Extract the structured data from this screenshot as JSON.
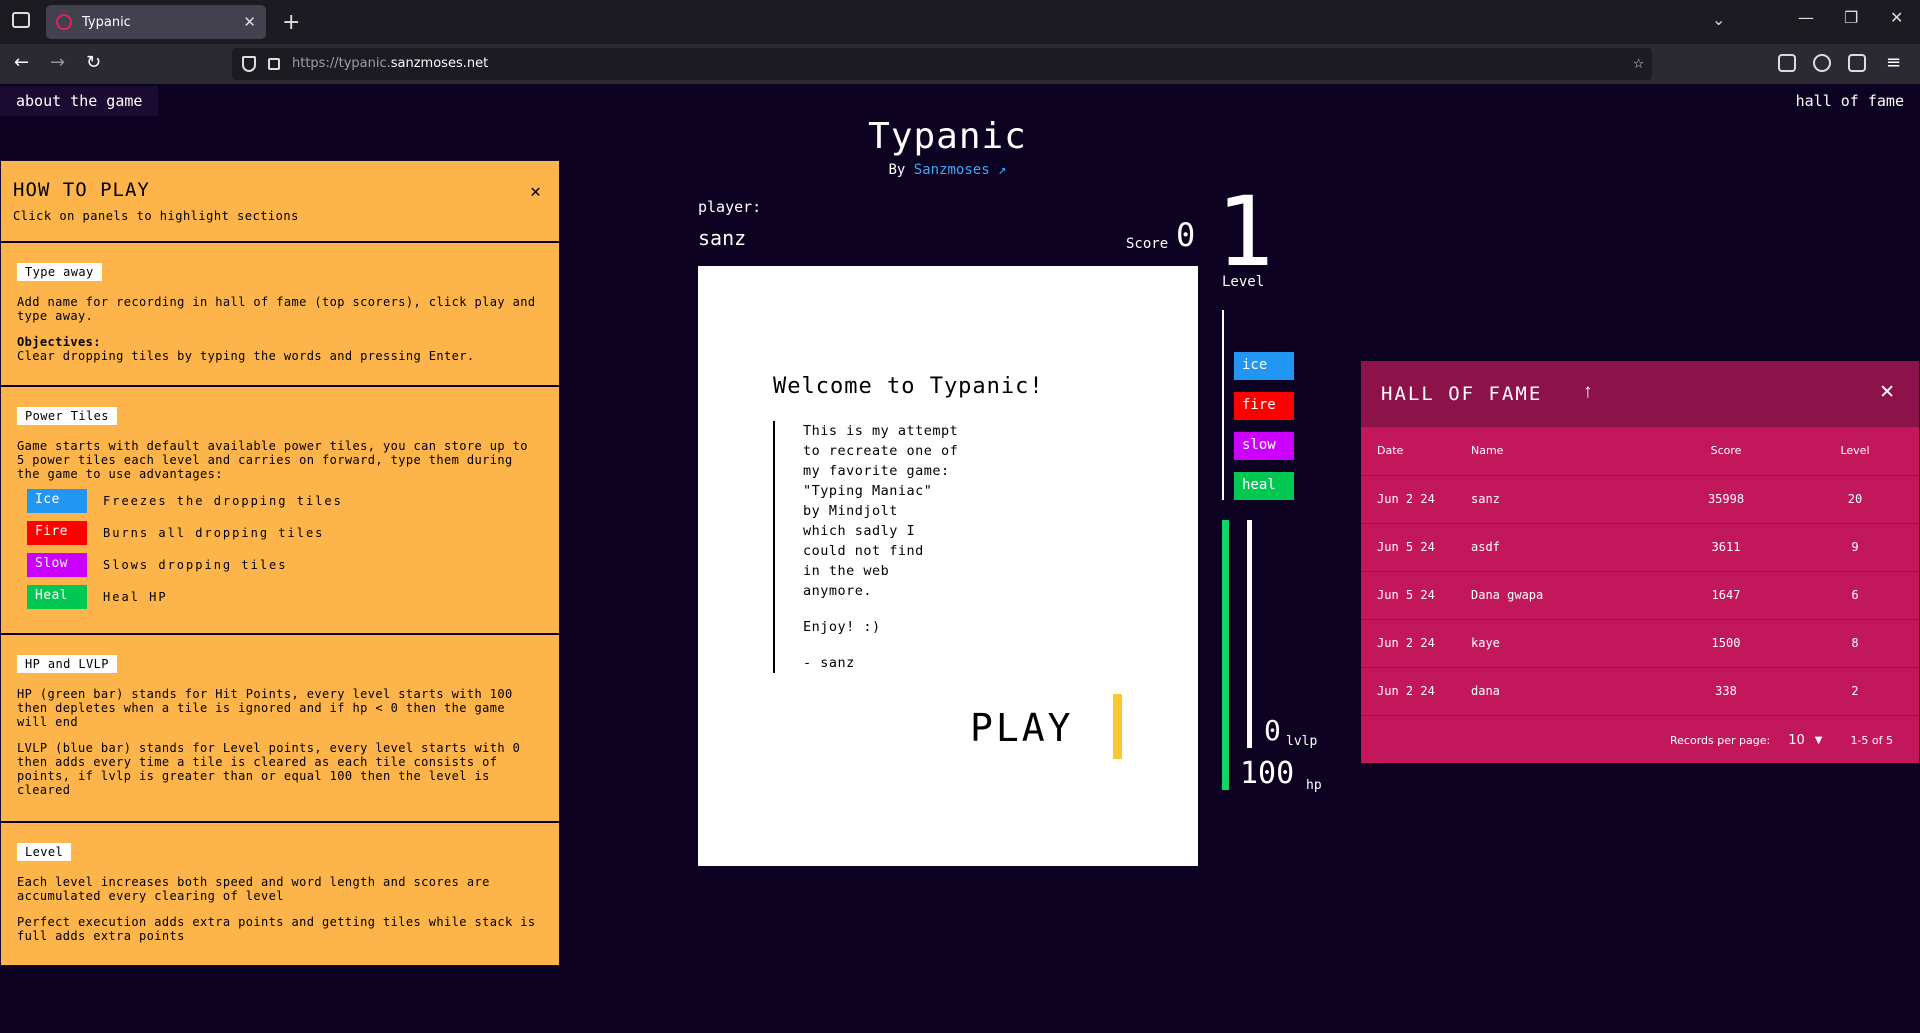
{
  "browser": {
    "tab_title": "Typanic",
    "url_prefix": "https://typanic.",
    "url_domain": "sanzmoses.net"
  },
  "nav": {
    "about": "about the game",
    "hall_of_fame": "hall of fame"
  },
  "header": {
    "title": "Typanic",
    "by": "By",
    "author": "Sanzmoses ↗"
  },
  "how_to_play": {
    "title": "HOW TO PLAY",
    "subtitle": "Click on panels to highlight sections",
    "type_away": {
      "tag": "Type away",
      "text": "Add name for recording in hall of fame (top scorers), click play and type away.",
      "objectives_label": "Objectives:",
      "objectives_text": "Clear dropping tiles by typing the words and pressing Enter."
    },
    "power_tiles": {
      "tag": "Power Tiles",
      "text": "Game starts with default available power tiles, you can store up to 5 power tiles each level and carries on forward, type them during the game to use advantages:",
      "tiles": [
        {
          "label": "Ice",
          "desc": "Freezes the dropping tiles",
          "color": "#2196f3"
        },
        {
          "label": "Fire",
          "desc": "Burns all dropping tiles",
          "color": "#ff0000"
        },
        {
          "label": "Slow",
          "desc": "Slows dropping tiles",
          "color": "#cc00ff"
        },
        {
          "label": "Heal",
          "desc": "Heal HP",
          "color": "#00c853"
        }
      ]
    },
    "hp_lvlp": {
      "tag": "HP and LVLP",
      "hp_text": "HP (green bar) stands for Hit Points, every level starts with 100 then depletes when a tile is ignored and if hp < 0 then the game will end",
      "lvlp_text": "LVLP (blue bar) stands for Level points, every level starts with 0 then adds every time a tile is cleared as each tile consists of points, if lvlp is greater than or equal 100 then the level is cleared"
    },
    "level": {
      "tag": "Level",
      "text1": "Each level increases both speed and word length and scores are accumulated every clearing of level",
      "text2": "Perfect execution adds extra points and getting tiles while stack is full adds extra points"
    }
  },
  "game": {
    "player_label": "player:",
    "player_name": "sanz",
    "score_label": "Score",
    "score": "0",
    "level": "1",
    "level_label": "Level",
    "welcome": "Welcome to Typanic!",
    "quote_lines": [
      "This is my attempt",
      "to recreate one of",
      "my favorite game:",
      "\"Typing Maniac\"",
      "by Mindjolt",
      "which sadly I",
      "could not find",
      "in the web",
      "anymore."
    ],
    "enjoy": "Enjoy! :)",
    "signature": "- sanz",
    "play": "PLAY",
    "power_stack": [
      {
        "label": "ice",
        "color": "#2196f3"
      },
      {
        "label": "fire",
        "color": "#ff0000"
      },
      {
        "label": "slow",
        "color": "#cc00ff"
      },
      {
        "label": "heal",
        "color": "#00c853"
      }
    ],
    "lvlp": "0",
    "lvlp_unit": "lvlp",
    "hp": "100",
    "hp_unit": "hp",
    "hp_percent": 100,
    "lvlp_percent": 0
  },
  "hall_of_fame": {
    "title": "HALL OF FAME",
    "columns": [
      "Date",
      "Name",
      "Score",
      "Level"
    ],
    "rows": [
      [
        "Jun 2 24",
        "sanz",
        "35998",
        "20"
      ],
      [
        "Jun 5 24",
        "asdf",
        "3611",
        "9"
      ],
      [
        "Jun 5 24",
        "Dana gwapa",
        "1647",
        "6"
      ],
      [
        "Jun 2 24",
        "kaye",
        "1500",
        "8"
      ],
      [
        "Jun 2 24",
        "dana",
        "338",
        "2"
      ]
    ],
    "records_per_page_label": "Records per page:",
    "records_per_page": "10",
    "range": "1-5 of 5"
  }
}
